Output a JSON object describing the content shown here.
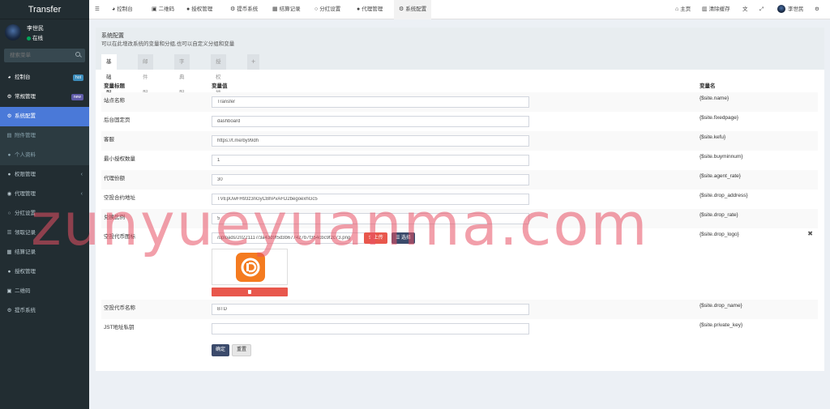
{
  "brand": "Transfer",
  "user": {
    "name": "李世民",
    "status": "在线"
  },
  "search": {
    "placeholder": "搜索菜单"
  },
  "sidebar": {
    "items": [
      {
        "label": "控制台",
        "icon": "dashboard-icon",
        "badge": "hot"
      },
      {
        "label": "常规管理",
        "icon": "cogs-icon",
        "badge": "new"
      },
      {
        "label": "系统配置",
        "icon": "cog-icon"
      },
      {
        "label": "附件管理",
        "icon": "file-icon"
      },
      {
        "label": "个人资料",
        "icon": "user-icon"
      },
      {
        "label": "权限管理",
        "icon": "group-icon"
      },
      {
        "label": "代理管理",
        "icon": "user-circle-icon"
      },
      {
        "label": "分红设置",
        "icon": "circle-icon"
      },
      {
        "label": "领取记录",
        "icon": "list-icon"
      },
      {
        "label": "结算记录",
        "icon": "table-icon"
      },
      {
        "label": "授权管理",
        "icon": "users-icon"
      },
      {
        "label": "二维码",
        "icon": "qrcode-icon"
      },
      {
        "label": "提币系统",
        "icon": "gear-icon"
      }
    ]
  },
  "topnav": {
    "tabs": [
      {
        "label": "控制台"
      },
      {
        "label": "二维码"
      },
      {
        "label": "授权管理"
      },
      {
        "label": "提币系统"
      },
      {
        "label": "结算记录"
      },
      {
        "label": "分红设置"
      },
      {
        "label": "代理管理"
      },
      {
        "label": "系统配置"
      }
    ],
    "home": "主页",
    "clear_cache": "清除缓存",
    "username": "李世民"
  },
  "page": {
    "title": "系统配置",
    "subtitle": "可以在此增改系统的变量和分组,也可以自定义分组和变量",
    "tabs": [
      "基础配置",
      "邮件配置",
      "字典配置",
      "授权地址"
    ],
    "plus": "+"
  },
  "table": {
    "headers": {
      "title": "变量标题",
      "value": "变量值",
      "name": "变量名"
    },
    "rows": [
      {
        "title": "站点名称",
        "value": "Transfer",
        "name": "{$site.name}"
      },
      {
        "title": "后台固定页",
        "value": "dashboard",
        "name": "{$site.fixedpage}"
      },
      {
        "title": "客服",
        "value": "https://t.me/by99dh",
        "name": "{$site.kefu}"
      },
      {
        "title": "最小授权数量",
        "value": "1",
        "name": "{$site.buyminnum}"
      },
      {
        "title": "代理份额",
        "value": "30",
        "name": "{$site.agent_rate}"
      },
      {
        "title": "空投合约地址",
        "value": "TVEpUwFH93z3nGyCBhPvAFD2begoexhGc5",
        "name": "{$site.drop_address}"
      },
      {
        "title": "兑换比例",
        "value": "5",
        "name": "{$site.drop_rate}"
      },
      {
        "title": "空投代币图标",
        "value": "/uploads/20221117/3a43d9f5d3b677427b7f354cbc9f2c73.png",
        "name": "{$site.drop_logo}"
      },
      {
        "title": "空投代币名称",
        "value": "BTD",
        "name": "{$site.drop_name}"
      },
      {
        "title": "JST地址私钥",
        "value": "",
        "name": "{$site.private_key}"
      }
    ],
    "upload_label": "上传",
    "choose_label": "选择"
  },
  "buttons": {
    "confirm": "确定",
    "reset": "重置"
  },
  "watermark": "zunyueyuanma.com"
}
